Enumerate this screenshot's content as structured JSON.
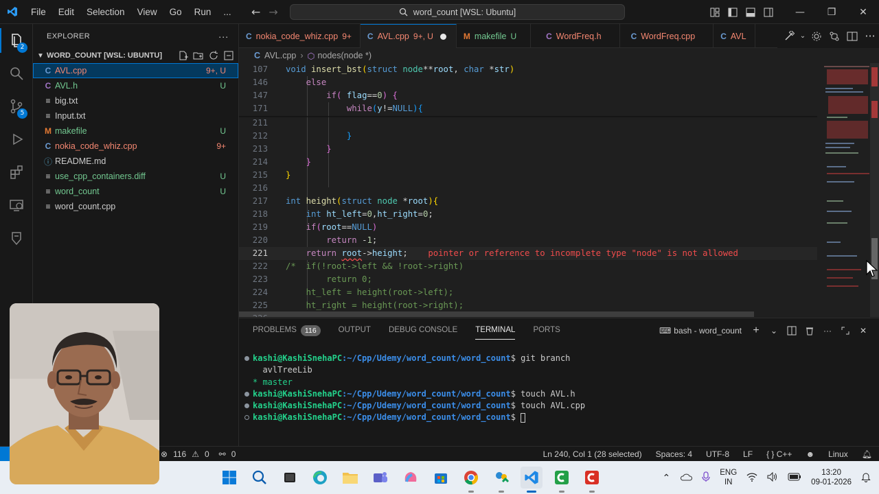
{
  "titlebar": {
    "menu": [
      "File",
      "Edit",
      "Selection",
      "View",
      "Go",
      "Run",
      "..."
    ],
    "command_center": "word_count [WSL: Ubuntu]",
    "window": {
      "minimize": "—",
      "restore": "❐",
      "close": "✕"
    }
  },
  "activity": {
    "explorer_badge": "2",
    "scm_badge": "5"
  },
  "explorer": {
    "title": "EXPLORER",
    "folder": "WORD_COUNT [WSL: UBUNTU]",
    "files": [
      {
        "icon": "C",
        "name": "AVL.cpp",
        "status": "9+, U",
        "color": "err",
        "selected": true
      },
      {
        "icon": "C",
        "name": "AVL.h",
        "status": "U",
        "color": "mod"
      },
      {
        "icon": "≡",
        "name": "big.txt",
        "status": "",
        "color": ""
      },
      {
        "icon": "≡",
        "name": "Input.txt",
        "status": "",
        "color": ""
      },
      {
        "icon": "M",
        "name": "makefile",
        "status": "U",
        "color": "mod"
      },
      {
        "icon": "C",
        "name": "nokia_code_whiz.cpp",
        "status": "9+",
        "color": "err"
      },
      {
        "icon": "ⓘ",
        "name": "README.md",
        "status": "",
        "color": ""
      },
      {
        "icon": "≡",
        "name": "use_cpp_containers.diff",
        "status": "U",
        "color": "mod"
      },
      {
        "icon": "≡",
        "name": "word_count",
        "status": "U",
        "color": "mod"
      },
      {
        "icon": "≡",
        "name": "word_count.cpp",
        "status": "",
        "color": ""
      }
    ]
  },
  "tabs": [
    {
      "icon": "C",
      "label": "nokia_code_whiz.cpp",
      "status": "9+",
      "kind": "err"
    },
    {
      "icon": "C",
      "label": "AVL.cpp",
      "status": "9+, U",
      "kind": "err",
      "active": true
    },
    {
      "icon": "M",
      "label": "makefile",
      "status": "U",
      "kind": "mod"
    },
    {
      "icon": "C",
      "label": "WordFreq.h",
      "status": "",
      "kind": "err"
    },
    {
      "icon": "C",
      "label": "WordFreq.cpp",
      "status": "",
      "kind": "err"
    },
    {
      "icon": "C",
      "label": "AVL",
      "status": "",
      "kind": "err"
    }
  ],
  "breadcrumb": {
    "file": "AVL.cpp",
    "symbol": "nodes(node *)"
  },
  "code": {
    "line_numbers": [
      "107",
      "146",
      "147",
      "171",
      "211",
      "212",
      "213",
      "214",
      "215",
      "216",
      "217",
      "218",
      "219",
      "220",
      "221",
      "222",
      "223",
      "224",
      "225",
      "226"
    ],
    "error_message": "pointer or reference to incomplete type \"node\" is not allowed"
  },
  "panel": {
    "tabs": [
      "PROBLEMS",
      "OUTPUT",
      "DEBUG CONSOLE",
      "TERMINAL",
      "PORTS"
    ],
    "problems_count": "116",
    "active_tab": "TERMINAL",
    "terminal_name": "bash - word_count",
    "prompt_user": "kashi@KashiSnehaPC",
    "prompt_path": ":~/Cpp/Udemy/word_count/word_count",
    "lines": [
      {
        "type": "cmd",
        "text": " git branch"
      },
      {
        "type": "out",
        "text": "  avlTreeLib"
      },
      {
        "type": "out-cur",
        "text": "* master"
      },
      {
        "type": "cmd",
        "text": " touch AVL.h"
      },
      {
        "type": "cmd",
        "text": " touch AVL.cpp"
      },
      {
        "type": "cmd",
        "text": " "
      }
    ]
  },
  "statusbar": {
    "errors": "116",
    "warnings": "0",
    "ports": "0",
    "position": "Ln 240, Col 1 (28 selected)",
    "spaces": "Spaces: 4",
    "encoding": "UTF-8",
    "eol": "LF",
    "language": "C++",
    "platform": "Linux"
  },
  "taskbar": {
    "lang_top": "ENG",
    "lang_bottom": "IN",
    "time": "13:20",
    "date": "09-01-2026"
  }
}
